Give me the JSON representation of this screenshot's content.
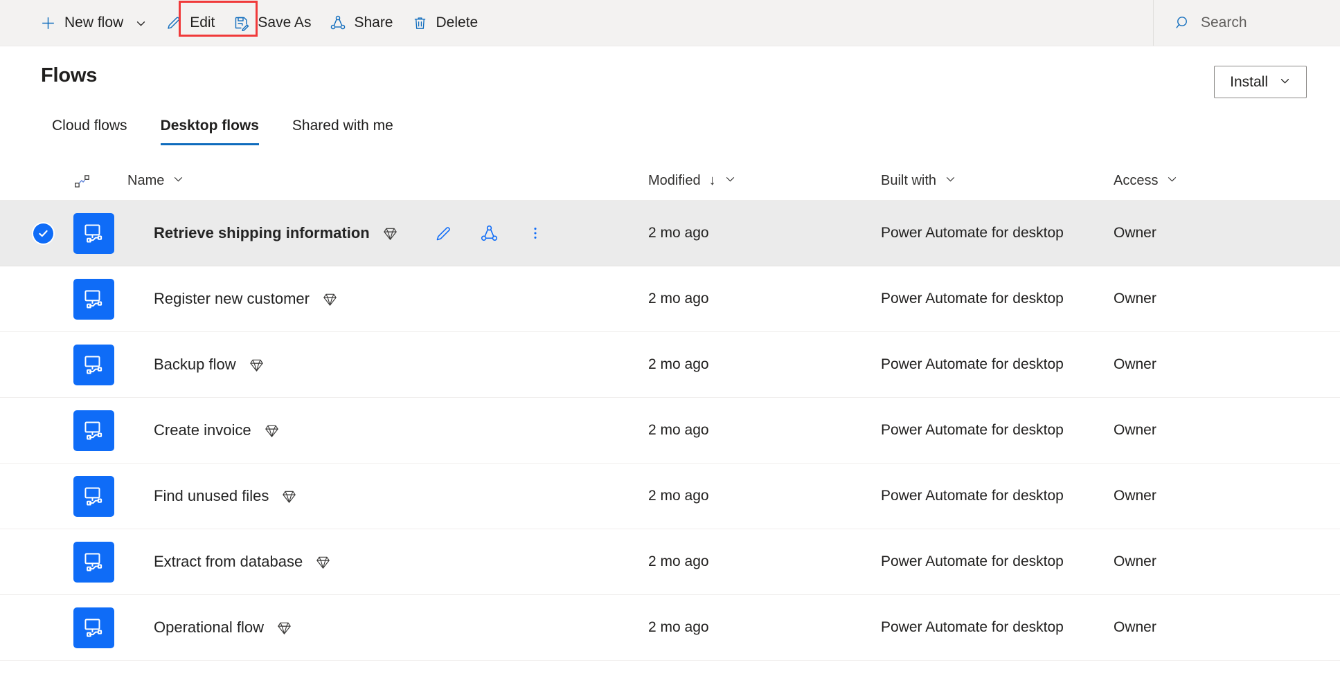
{
  "commandbar": {
    "buttons": [
      {
        "label": "New flow",
        "icon": "plus-icon",
        "has_chevron": true
      },
      {
        "label": "Edit",
        "icon": "pencil-icon",
        "has_chevron": false
      },
      {
        "label": "Save As",
        "icon": "save-as-icon",
        "has_chevron": false,
        "highlighted": true
      },
      {
        "label": "Share",
        "icon": "share-icon",
        "has_chevron": false
      },
      {
        "label": "Delete",
        "icon": "trash-icon",
        "has_chevron": false
      }
    ],
    "search": {
      "placeholder": "Search",
      "icon": "search-icon"
    },
    "highlight_color": "#f03a3a"
  },
  "header": {
    "title": "Flows",
    "install_label": "Install",
    "install_icon": "chevron-down-icon"
  },
  "tabs": [
    {
      "label": "Cloud flows",
      "active": false
    },
    {
      "label": "Desktop flows",
      "active": true
    },
    {
      "label": "Shared with me",
      "active": false
    }
  ],
  "table": {
    "columns": {
      "type_icon": "flow-type-icon",
      "name": "Name",
      "modified": "Modified",
      "modified_sort": "↓",
      "built_with": "Built with",
      "access": "Access"
    },
    "rows": [
      {
        "name": "Retrieve shipping information",
        "modified": "2 mo ago",
        "built_with": "Power Automate for desktop",
        "access": "Owner",
        "selected": true,
        "premium": true
      },
      {
        "name": "Register new customer",
        "modified": "2 mo ago",
        "built_with": "Power Automate for desktop",
        "access": "Owner",
        "selected": false,
        "premium": true
      },
      {
        "name": "Backup flow",
        "modified": "2 mo ago",
        "built_with": "Power Automate for desktop",
        "access": "Owner",
        "selected": false,
        "premium": true
      },
      {
        "name": "Create invoice",
        "modified": "2 mo ago",
        "built_with": "Power Automate for desktop",
        "access": "Owner",
        "selected": false,
        "premium": true
      },
      {
        "name": "Find unused files",
        "modified": "2 mo ago",
        "built_with": "Power Automate for desktop",
        "access": "Owner",
        "selected": false,
        "premium": true
      },
      {
        "name": "Extract from database",
        "modified": "2 mo ago",
        "built_with": "Power Automate for desktop",
        "access": "Owner",
        "selected": false,
        "premium": true
      },
      {
        "name": "Operational flow",
        "modified": "2 mo ago",
        "built_with": "Power Automate for desktop",
        "access": "Owner",
        "selected": false,
        "premium": true
      }
    ],
    "row_actions": [
      {
        "name": "edit-flow-icon",
        "title": "Edit"
      },
      {
        "name": "share-flow-icon",
        "title": "Share"
      },
      {
        "name": "more-options-icon",
        "title": "More commands"
      }
    ]
  },
  "colors": {
    "accent_blue": "#0f6cf7",
    "command_icon_blue": "#0f6cbd",
    "selected_row_bg": "#ebebeb",
    "command_bar_bg": "#f3f2f1"
  }
}
